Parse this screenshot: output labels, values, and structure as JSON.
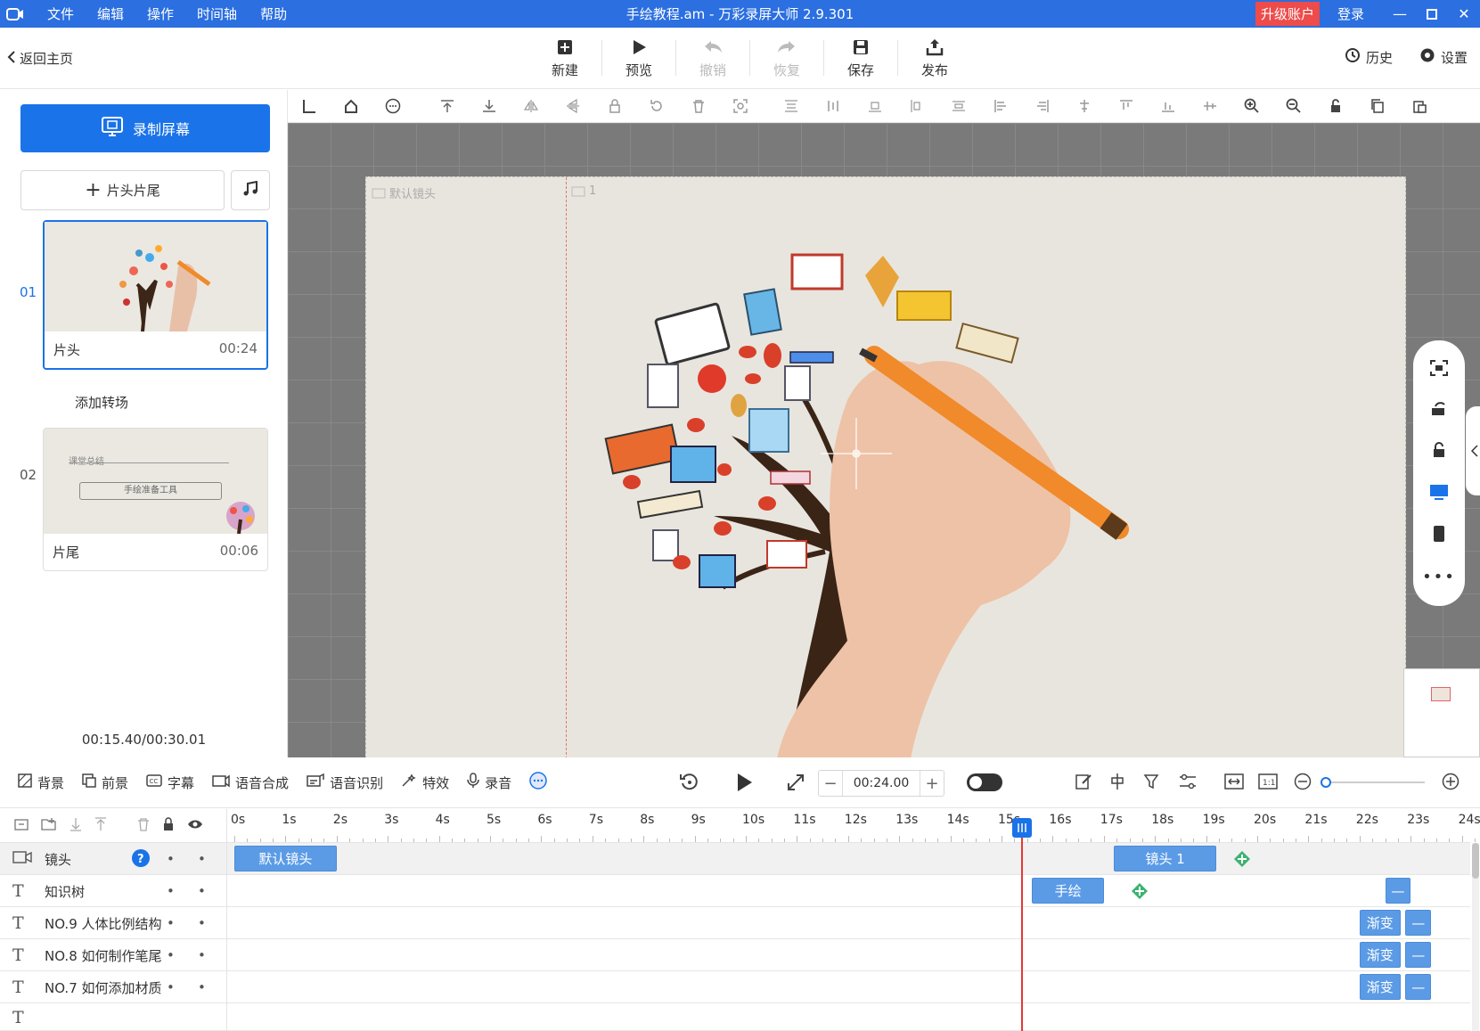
{
  "window": {
    "title": "手绘教程.am - 万彩录屏大师 2.9.301",
    "menu": [
      "文件",
      "编辑",
      "操作",
      "时间轴",
      "帮助"
    ],
    "upgrade_label": "升级账户",
    "login_label": "登录"
  },
  "toolbar": {
    "back_label": "返回主页",
    "buttons": [
      {
        "label": "新建",
        "icon": "new-icon",
        "enabled": true
      },
      {
        "label": "预览",
        "icon": "play-icon",
        "enabled": true
      },
      {
        "label": "撤销",
        "icon": "undo-icon",
        "enabled": false
      },
      {
        "label": "恢复",
        "icon": "redo-icon",
        "enabled": false
      },
      {
        "label": "保存",
        "icon": "save-icon",
        "enabled": true
      },
      {
        "label": "发布",
        "icon": "publish-icon",
        "enabled": true
      }
    ],
    "history_label": "历史",
    "settings_label": "设置"
  },
  "left_panel": {
    "record_label": "录制屏幕",
    "title_tail_label": "片头片尾",
    "scenes": [
      {
        "number": "01",
        "name": "片头",
        "duration": "00:24",
        "active": true
      },
      {
        "number": "02",
        "name": "片尾",
        "duration": "00:06",
        "active": false
      }
    ],
    "add_transition_label": "添加转场",
    "scene2_thumb_text": "课堂总结",
    "scene2_thumb_box": "手绘准备工具",
    "time_info": "00:15.40/00:30.01"
  },
  "canvas": {
    "camera_labels": [
      "默认镜头",
      "1"
    ]
  },
  "bottom_toolbar": {
    "items": [
      {
        "label": "背景",
        "icon": "background-icon"
      },
      {
        "label": "前景",
        "icon": "foreground-icon"
      },
      {
        "label": "字幕",
        "icon": "subtitle-icon"
      },
      {
        "label": "语音合成",
        "icon": "tts-icon"
      },
      {
        "label": "语音识别",
        "icon": "speech-recognition-icon"
      },
      {
        "label": "特效",
        "icon": "effects-icon"
      },
      {
        "label": "录音",
        "icon": "microphone-icon"
      }
    ],
    "time_value": "00:24.00",
    "minus": "−",
    "plus": "+"
  },
  "timeline": {
    "ticks": [
      "0s",
      "1s",
      "2s",
      "3s",
      "4s",
      "5s",
      "6s",
      "7s",
      "8s",
      "9s",
      "10s",
      "11s",
      "12s",
      "13s",
      "14s",
      "15s",
      "16s",
      "17s",
      "18s",
      "19s",
      "20s",
      "21s",
      "22s",
      "23s",
      "24s"
    ],
    "playhead_seconds": 15.4,
    "tracks": [
      {
        "name": "镜头",
        "icon": "camera-icon",
        "clips": [
          {
            "label": "默认镜头",
            "start": 0,
            "end": 2
          },
          {
            "label": "镜头 1",
            "start": 17.2,
            "end": 19.2
          }
        ],
        "keyframes": [
          19.7
        ]
      },
      {
        "name": "知识树",
        "icon": "text-icon",
        "clips": [
          {
            "label": "手绘",
            "start": 15.6,
            "end": 17
          },
          {
            "label": "",
            "start": 22.5,
            "end": 23
          }
        ],
        "keyframes": [
          17.7
        ]
      },
      {
        "name": "NO.9  人体比例结构",
        "icon": "text-icon",
        "clips": [
          {
            "label": "渐变",
            "start": 22,
            "end": 22.8
          },
          {
            "label": "",
            "start": 22.9,
            "end": 23.4
          }
        ],
        "keyframes": []
      },
      {
        "name": "NO.8  如何制作笔尾",
        "icon": "text-icon",
        "clips": [
          {
            "label": "渐变",
            "start": 22,
            "end": 22.8
          },
          {
            "label": "",
            "start": 22.9,
            "end": 23.4
          }
        ],
        "keyframes": []
      },
      {
        "name": "NO.7  如何添加材质",
        "icon": "text-icon",
        "clips": [
          {
            "label": "渐变",
            "start": 22,
            "end": 22.8
          },
          {
            "label": "",
            "start": 22.9,
            "end": 23.4
          }
        ],
        "keyframes": []
      }
    ]
  }
}
